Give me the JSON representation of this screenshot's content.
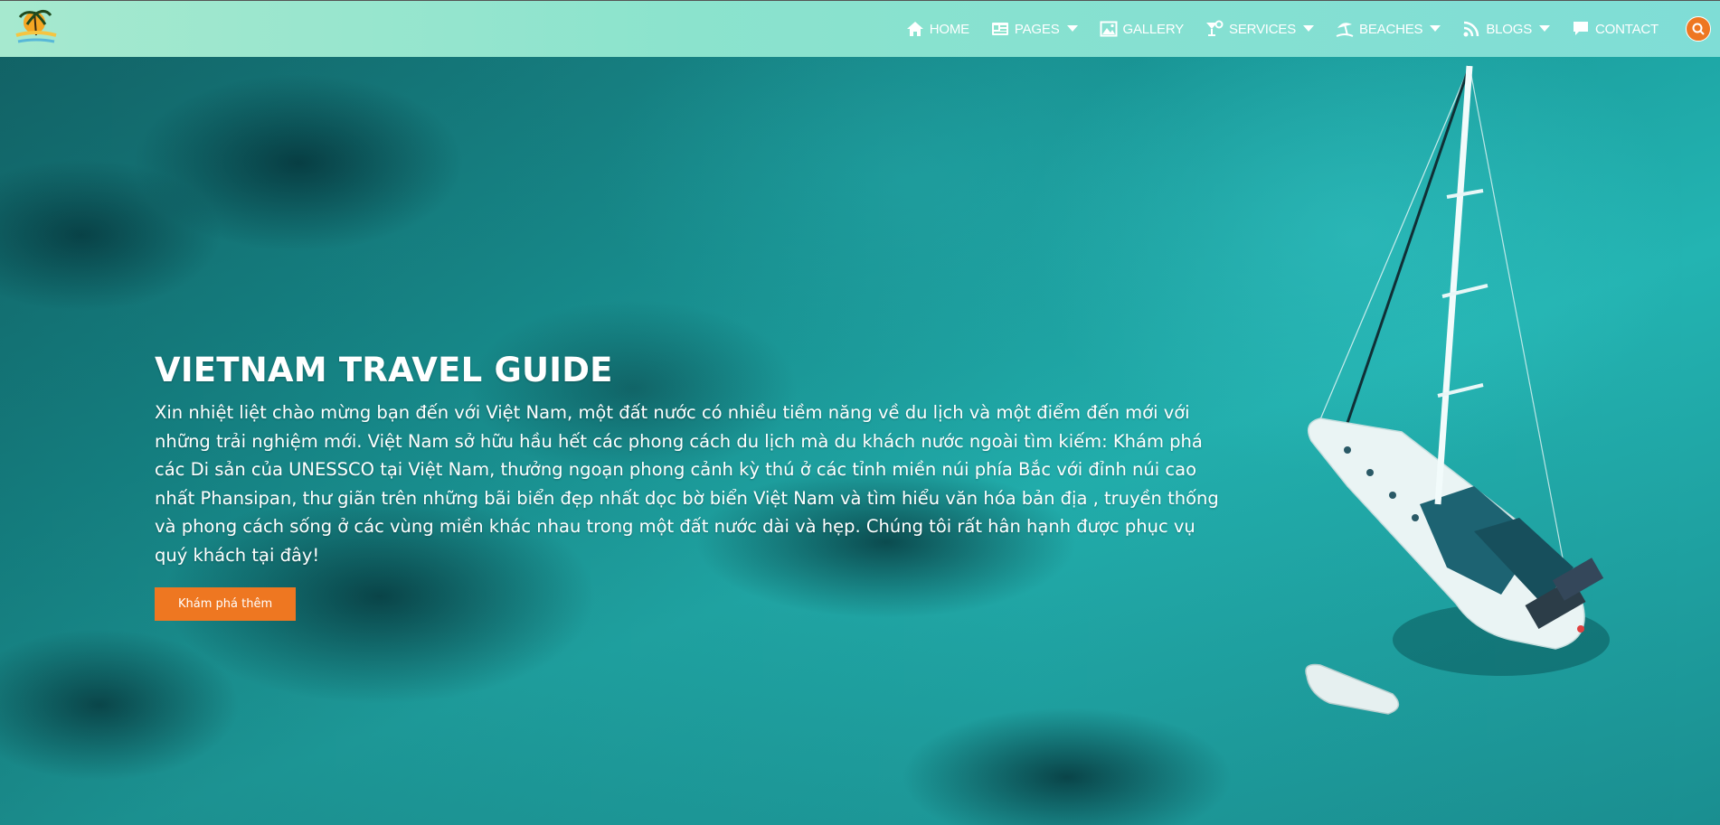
{
  "site": {
    "logo_alt": "Beautiful Beach"
  },
  "nav": {
    "items": [
      {
        "label": "HOME",
        "icon": "home-icon",
        "has_dropdown": false
      },
      {
        "label": "PAGES",
        "icon": "pages-icon",
        "has_dropdown": true
      },
      {
        "label": "GALLERY",
        "icon": "gallery-icon",
        "has_dropdown": false
      },
      {
        "label": "SERVICES",
        "icon": "cocktail-icon",
        "has_dropdown": true
      },
      {
        "label": "BEACHES",
        "icon": "beach-umbrella-icon",
        "has_dropdown": true
      },
      {
        "label": "BLOGS",
        "icon": "rss-icon",
        "has_dropdown": true
      },
      {
        "label": "CONTACT",
        "icon": "chat-icon",
        "has_dropdown": false
      }
    ],
    "search_icon": "search-icon"
  },
  "hero": {
    "title": "VIETNAM TRAVEL GUIDE",
    "description": "Xin nhiệt liệt chào mừng bạn đến với Việt Nam, một đất nước có nhiều tiềm năng về du lịch và một điểm đến mới với những trải nghiệm mới. Việt Nam sở hữu hầu hết các phong cách du lịch mà du khách nước ngoài tìm kiếm: Khám phá các Di sản của UNESSCO tại Việt Nam, thưởng ngoạn phong cảnh kỳ thú ở các tỉnh miền núi phía Bắc với đỉnh núi cao nhất Phansipan, thư giãn trên những bãi biển đẹp nhất dọc bờ biển Việt Nam và tìm hiểu văn hóa bản địa , truyền thống và phong cách sống ở các vùng miền khác nhau trong một đất nước dài và hẹp. Chúng tôi rất hân hạnh được phục vụ quý khách tại đây!",
    "cta_label": "Khám phá thêm"
  },
  "colors": {
    "accent": "#ee7721",
    "navbar_start": "#a6e9cf",
    "navbar_end": "#7fddd6",
    "sea": "#1a9c9c"
  }
}
